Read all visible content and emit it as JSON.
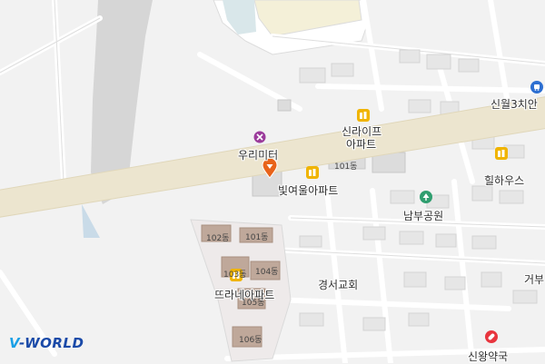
{
  "logo": {
    "prefix": "V",
    "rest": "-WORLD",
    "prefix_color": "#1aa0e6",
    "rest_color": "#1a4aa8"
  },
  "labels": {
    "woori_meter": "우리미터",
    "shilife": "신라이프",
    "apartment": "아파트",
    "bitneoul": "빛여울아파트",
    "b101_east": "101동",
    "hillhouse": "힐하우스",
    "nambu_park": "남부공원",
    "gyeongseo_church": "경서교회",
    "sinwol3": "신월3치안",
    "tteurane": "뜨라네아파트",
    "b102": "102동",
    "b101": "101동",
    "b103": "103동",
    "b104": "104동",
    "b105": "105동",
    "b106": "106동",
    "sinwang_pharmacy": "신왕약국",
    "geobu": "거부"
  },
  "colors": {
    "background": "#f2f2f2",
    "main_road": "#ece5cf",
    "apartment_icon": "#f0b400",
    "park_icon": "#2f9e6f",
    "pharmacy_icon": "#e8353e",
    "marker": "#e8631a",
    "shop_icon": "#9b3b9b",
    "bus_icon": "#2d6fd1"
  }
}
